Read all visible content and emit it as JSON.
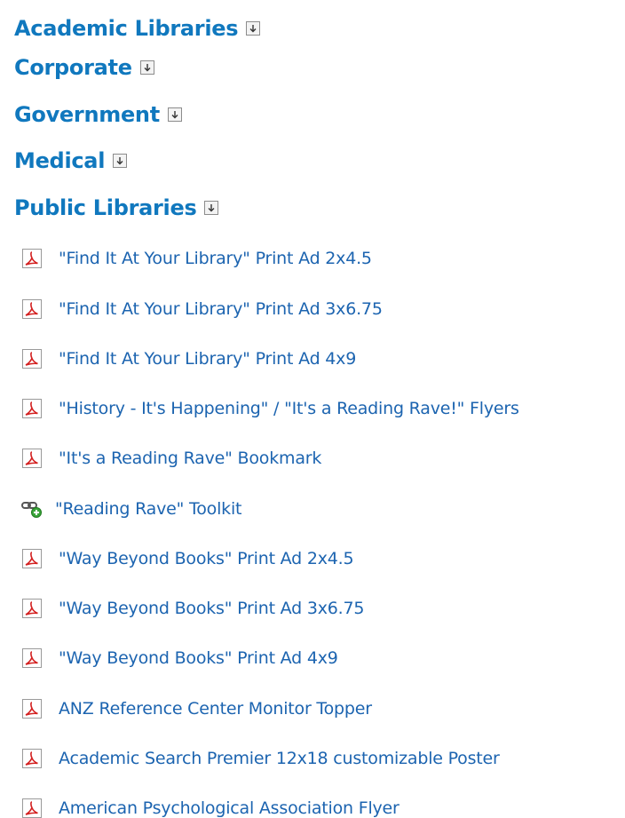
{
  "categories": [
    {
      "label": "Academic Libraries",
      "icon": "expand-icon"
    },
    {
      "label": "Corporate",
      "icon": "expand-icon"
    },
    {
      "label": "Government",
      "icon": "expand-icon"
    },
    {
      "label": "Medical",
      "icon": "expand-icon"
    },
    {
      "label": "Public Libraries",
      "icon": "expand-icon"
    }
  ],
  "items": [
    {
      "label": "\"Find It At Your Library\" Print Ad 2x4.5",
      "icon": "pdf-icon"
    },
    {
      "label": "\"Find It At Your Library\" Print Ad 3x6.75",
      "icon": "pdf-icon"
    },
    {
      "label": "\"Find It At Your Library\" Print Ad 4x9",
      "icon": "pdf-icon"
    },
    {
      "label": "\"History - It's Happening\" / \"It's a Reading Rave!\" Flyers",
      "icon": "pdf-icon"
    },
    {
      "label": "\"It's a Reading Rave\" Bookmark",
      "icon": "pdf-icon"
    },
    {
      "label": "\"Reading Rave\" Toolkit",
      "icon": "link-icon"
    },
    {
      "label": "\"Way Beyond Books\" Print Ad 2x4.5",
      "icon": "pdf-icon"
    },
    {
      "label": "\"Way Beyond Books\" Print Ad 3x6.75",
      "icon": "pdf-icon"
    },
    {
      "label": "\"Way Beyond Books\" Print Ad 4x9",
      "icon": "pdf-icon"
    },
    {
      "label": "ANZ Reference Center Monitor Topper",
      "icon": "pdf-icon"
    },
    {
      "label": "Academic Search Premier 12x18 customizable Poster",
      "icon": "pdf-icon"
    },
    {
      "label": "American Psychological Association Flyer",
      "icon": "pdf-icon"
    }
  ],
  "colors": {
    "category_text": "#1078be",
    "item_text": "#1c64b0",
    "pdf_red": "#d32020",
    "link_green": "#3aa53a"
  }
}
